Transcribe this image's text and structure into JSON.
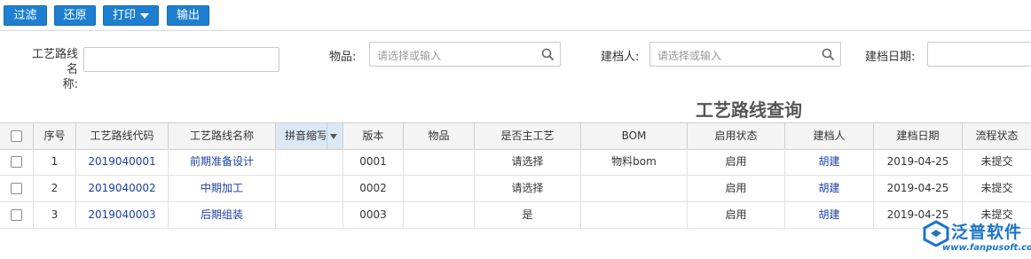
{
  "toolbar": {
    "filter": "过滤",
    "restore": "还原",
    "print": "打印",
    "export": "输出"
  },
  "search": {
    "route_name_label_1": "工艺路线名",
    "route_name_label_2": "称:",
    "item_label": "物品:",
    "item_placeholder": "请选择或输入",
    "creator_label": "建档人:",
    "creator_placeholder": "请选择或输入",
    "date_label": "建档日期:"
  },
  "page_title": "工艺路线查询",
  "table": {
    "headers": [
      "序号",
      "工艺路线代码",
      "工艺路线名称",
      "拼音缩写",
      "版本",
      "物品",
      "是否主工艺",
      "BOM",
      "启用状态",
      "建档人",
      "建档日期",
      "流程状态"
    ],
    "rows": [
      {
        "no": "1",
        "code": "2019040001",
        "name": "前期准备设计",
        "pinyin": "",
        "version": "0001",
        "item": "",
        "main": "请选择",
        "bom": "物料bom",
        "status": "启用",
        "creator": "胡建",
        "date": "2019-04-25",
        "flow": "未提交"
      },
      {
        "no": "2",
        "code": "2019040002",
        "name": "中期加工",
        "pinyin": "",
        "version": "0002",
        "item": "",
        "main": "请选择",
        "bom": "",
        "status": "启用",
        "creator": "胡建",
        "date": "2019-04-25",
        "flow": "未提交"
      },
      {
        "no": "3",
        "code": "2019040003",
        "name": "后期组装",
        "pinyin": "",
        "version": "0003",
        "item": "",
        "main": "是",
        "bom": "",
        "status": "启用",
        "creator": "胡建",
        "date": "2019-04-25",
        "flow": "未提交"
      }
    ]
  },
  "logo": {
    "name": "泛普软件",
    "url": "www.fanpusoft.com"
  },
  "colors": {
    "button": "#1e7fd0",
    "link": "#1a3fa6",
    "logo_blue": "#1b74c9"
  }
}
